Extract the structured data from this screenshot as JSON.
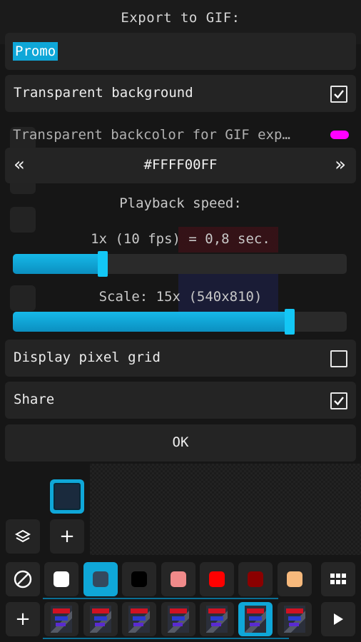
{
  "dialog": {
    "title": "Export to GIF:",
    "file_name": "Promo",
    "transparent_background": {
      "label": "Transparent background",
      "checked": true
    },
    "transparent_backcolor": {
      "label": "Transparent backcolor for GIF exp…",
      "swatch_color": "#ff00ff"
    },
    "color_selector": {
      "prev": "«",
      "value": "#FFFF00FF",
      "next": "»"
    },
    "playback": {
      "heading": "Playback speed:",
      "value_text": "1x (10 fps) = 0,8 sec.",
      "level": 0.27
    },
    "scale": {
      "value_text": "Scale: 15x (540x810)",
      "level": 0.83
    },
    "pixel_grid": {
      "label": "Display pixel grid",
      "checked": false
    },
    "share": {
      "label": "Share",
      "checked": true
    },
    "ok_label": "OK"
  },
  "background_app": {
    "layers_icon": "layers-icon",
    "add_layer": "+",
    "palette": {
      "colors": [
        "#ffffff",
        "#34495e",
        "#000000",
        "#f08a8a",
        "#ff0000",
        "#8b0000",
        "#f7b97c"
      ],
      "selected_index": 1,
      "grid_icon": "grid-icon",
      "no_color_icon": "no-color-icon"
    },
    "frames": {
      "add": "+",
      "count": 7,
      "selected_index": 5,
      "play_icon": "play-icon"
    },
    "accent_color": "#0fa7d8"
  }
}
